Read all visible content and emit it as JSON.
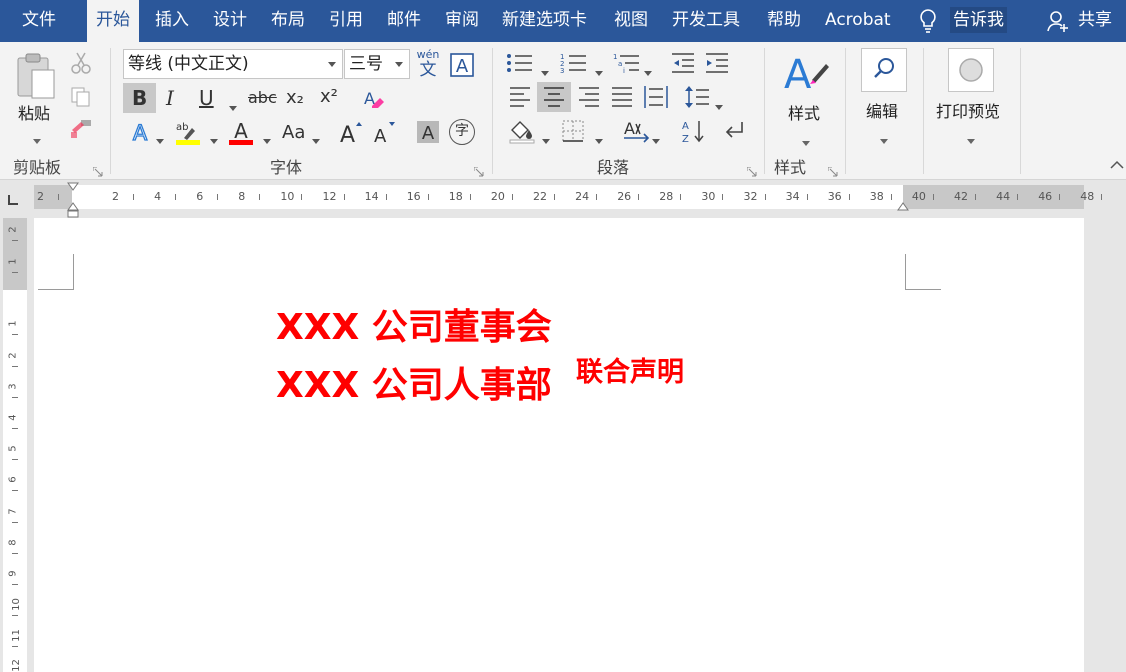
{
  "menu": {
    "tabs": [
      "文件",
      "开始",
      "插入",
      "设计",
      "布局",
      "引用",
      "邮件",
      "审阅",
      "新建选项卡",
      "视图",
      "开发工具",
      "帮助",
      "Acrobat"
    ],
    "active_tab": "开始",
    "tell_me": "告诉我",
    "share": "共享"
  },
  "ribbon": {
    "clipboard": {
      "group": "剪贴板",
      "paste": "粘贴"
    },
    "font": {
      "group": "字体",
      "font_name": "等线 (中文正文)",
      "font_size": "三号",
      "phonetic_top": "wén",
      "phonetic_bottom": "文",
      "bold": "B",
      "italic": "I",
      "underline": "U",
      "strike": "abc",
      "subscript": "x₂",
      "superscript": "x²",
      "change_case": "Aa",
      "highlight_label": "ab",
      "enclose_char": "字",
      "colors": {
        "highlight": "#ffff00",
        "font": "#ff0000"
      }
    },
    "paragraph": {
      "group": "段落"
    },
    "styles": {
      "group": "样式",
      "styles_button": "样式"
    },
    "editing": {
      "edit_button": "编辑"
    },
    "print_preview": {
      "button": "打印预览"
    }
  },
  "ruler": {
    "h_numbers": [
      "2",
      "2",
      "4",
      "6",
      "8",
      "10",
      "12",
      "14",
      "16",
      "18",
      "20",
      "22",
      "24",
      "26",
      "28",
      "30",
      "32",
      "34",
      "36",
      "38",
      "40",
      "42",
      "44",
      "46",
      "48"
    ],
    "v_numbers": [
      "2",
      "1",
      "1",
      "2",
      "3",
      "4",
      "5",
      "6",
      "7",
      "8",
      "9",
      "10",
      "11",
      "12"
    ]
  },
  "document": {
    "line1": "XXX 公司董事会",
    "line2": "XXX 公司人事部",
    "superscript": "联合声明",
    "text_color": "#ff0000"
  },
  "theme": {
    "accent": "#2b579a"
  }
}
